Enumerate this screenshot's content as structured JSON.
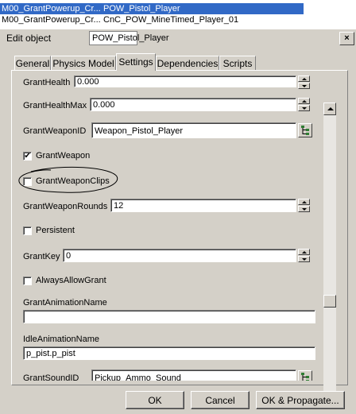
{
  "background_list": {
    "rows": [
      {
        "col1": "M00_GrantPowerup_Cr...",
        "col2": "POW_Pistol_Player",
        "selected": true
      },
      {
        "col1": "M00_GrantPowerup_Cr...",
        "col2": "CnC_POW_MineTimed_Player_01",
        "selected": false
      }
    ]
  },
  "dialog": {
    "title": "Edit object",
    "object_name": "POW_Pistol_Player",
    "close_glyph": "×"
  },
  "tabs": [
    "General",
    "Physics Model",
    "Settings",
    "Dependencies",
    "Scripts"
  ],
  "active_tab": "Settings",
  "settings": {
    "grant_health_label": "GrantHealth",
    "grant_health_value": "0.000",
    "grant_health_max_label": "GrantHealthMax",
    "grant_health_max_value": "0.000",
    "grant_weapon_id_label": "GrantWeaponID",
    "grant_weapon_id_value": "Weapon_Pistol_Player",
    "grant_weapon_label": "GrantWeapon",
    "grant_weapon_checked": true,
    "grant_weapon_clips_label": "GrantWeaponClips",
    "grant_weapon_clips_checked": false,
    "grant_weapon_rounds_label": "GrantWeaponRounds",
    "grant_weapon_rounds_value": "12",
    "persistent_label": "Persistent",
    "persistent_checked": false,
    "grant_key_label": "GrantKey",
    "grant_key_value": "0",
    "always_allow_grant_label": "AlwaysAllowGrant",
    "always_allow_grant_checked": false,
    "grant_animation_name_label": "GrantAnimationName",
    "grant_animation_name_value": "",
    "idle_animation_name_label": "IdleAnimationName",
    "idle_animation_name_value": "p_pist.p_pist",
    "grant_sound_id_label": "GrantSoundID",
    "grant_sound_id_value": "Pickup_Ammo_Sound"
  },
  "buttons": {
    "ok": "OK",
    "cancel": "Cancel",
    "ok_propagate": "OK & Propagate..."
  },
  "colors": {
    "selection": "#3169c6",
    "face": "#d4d0c8"
  }
}
